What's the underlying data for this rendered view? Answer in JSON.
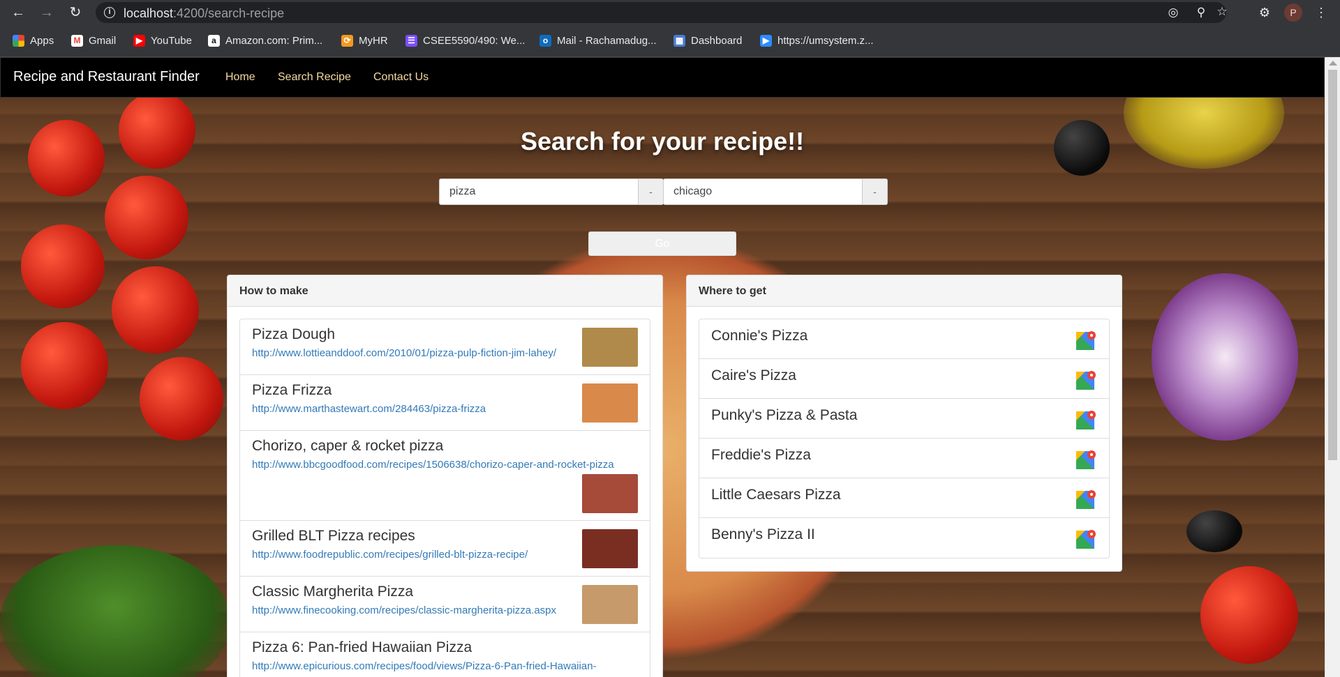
{
  "browser": {
    "url_host": "localhost",
    "url_path": ":4200/search-recipe",
    "profile_initial": "P",
    "bookmarks": [
      {
        "label": "Apps",
        "icon": "apps-grid-icon",
        "color": "#e8453c"
      },
      {
        "label": "Gmail",
        "icon": "gmail-icon",
        "color": "#ea4335"
      },
      {
        "label": "YouTube",
        "icon": "youtube-icon",
        "color": "#ff0000"
      },
      {
        "label": "Amazon.com: Prim...",
        "icon": "amazon-icon",
        "color": "#ffffff"
      },
      {
        "label": "MyHR",
        "icon": "myhr-icon",
        "color": "#f29a1f"
      },
      {
        "label": "CSEE5590/490: We...",
        "icon": "course-icon",
        "color": "#7c4dff"
      },
      {
        "label": "Mail - Rachamadug...",
        "icon": "outlook-icon",
        "color": "#0f6cbd"
      },
      {
        "label": "Dashboard",
        "icon": "dashboard-icon",
        "color": "#4a7bd0"
      },
      {
        "label": "https://umsystem.z...",
        "icon": "zoom-icon",
        "color": "#2d8cff"
      }
    ]
  },
  "site": {
    "brand": "Recipe and Restaurant Finder",
    "nav": [
      "Home",
      "Search Recipe",
      "Contact Us"
    ],
    "hero_title": "Search for your recipe!!",
    "search": {
      "recipe_value": "pizza",
      "city_value": "chicago",
      "addon_label": "-",
      "go_label": "Go"
    }
  },
  "how_to_make": {
    "heading": "How to make",
    "recipes": [
      {
        "title": "Pizza Dough",
        "url": "http://www.lottieanddoof.com/2010/01/pizza-pulp-fiction-jim-lahey/",
        "thumb_color": "#b08a4a"
      },
      {
        "title": "Pizza Frizza",
        "url": "http://www.marthastewart.com/284463/pizza-frizza",
        "thumb_color": "#d9894a"
      },
      {
        "title": "Chorizo, caper & rocket pizza",
        "url": "http://www.bbcgoodfood.com/recipes/1506638/chorizo-caper-and-rocket-pizza",
        "thumb_color": "#a64a3a"
      },
      {
        "title": "Grilled BLT Pizza recipes",
        "url": "http://www.foodrepublic.com/recipes/grilled-blt-pizza-recipe/",
        "thumb_color": "#7a2e22"
      },
      {
        "title": "Classic Margherita Pizza",
        "url": "http://www.finecooking.com/recipes/classic-margherita-pizza.aspx",
        "thumb_color": "#c69a6a"
      },
      {
        "title": "Pizza 6: Pan-fried Hawaiian Pizza",
        "url": "http://www.epicurious.com/recipes/food/views/Pizza-6-Pan-fried-Hawaiian-",
        "thumb_color": "#c0a070"
      }
    ]
  },
  "where_to_get": {
    "heading": "Where to get",
    "places": [
      "Connie's Pizza",
      "Caire's Pizza",
      "Punky's Pizza & Pasta",
      "Freddie's Pizza",
      "Little Caesars Pizza",
      "Benny's Pizza II"
    ]
  }
}
